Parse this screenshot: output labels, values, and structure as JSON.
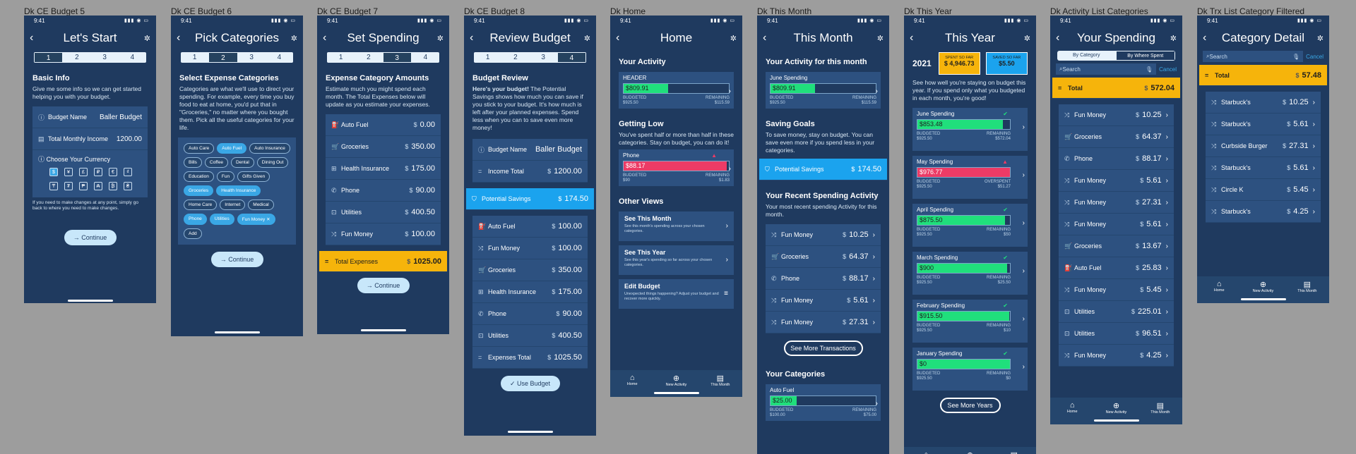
{
  "status_time": "9:41",
  "frames": {
    "f1": {
      "label": "Dk  CE Budget 5",
      "title": "Let's Start",
      "steps": [
        "1",
        "2",
        "3",
        "4"
      ],
      "heading": "Basic Info",
      "intro": "Give me some info so we can get started helping you with your budget.",
      "fields": [
        {
          "label": "Budget Name",
          "value": "Baller Budget"
        },
        {
          "label": "Total Monthly Income",
          "value": "1200.00"
        }
      ],
      "currency_label": "Choose Your Currency",
      "currencies": [
        "$",
        "¥",
        "£",
        "₽",
        "€",
        "₫",
        "₸",
        "₮",
        "₱",
        "₳",
        "₿",
        "₴"
      ],
      "note": "If you need to make changes at any point, simply go back to where you need to make changes.",
      "continue": "→ Continue"
    },
    "f2": {
      "label": "Dk  CE Budget 6",
      "title": "Pick Categories",
      "steps": [
        "1",
        "2",
        "3",
        "4"
      ],
      "heading": "Select Expense Categories",
      "intro": "Categories are what we'll use to direct your spending. For example, every time you buy food to eat at home, you'd put that in \"Groceries,\" no matter where you bought them. Pick all the useful categories for your life.",
      "chips": [
        {
          "t": "Auto Care",
          "s": false
        },
        {
          "t": "Auto Fuel",
          "s": true
        },
        {
          "t": "Auto Insurance",
          "s": false
        },
        {
          "t": "Bills",
          "s": false
        },
        {
          "t": "Coffee",
          "s": false
        },
        {
          "t": "Dental",
          "s": false
        },
        {
          "t": "Dining Out",
          "s": false
        },
        {
          "t": "Education",
          "s": false
        },
        {
          "t": "Fun",
          "s": false
        },
        {
          "t": "Gifts Given",
          "s": false
        },
        {
          "t": "Groceries",
          "s": true
        },
        {
          "t": "Health Insurance",
          "s": true
        },
        {
          "t": "Home Care",
          "s": false
        },
        {
          "t": "Internet",
          "s": false
        },
        {
          "t": "Medical",
          "s": false
        },
        {
          "t": "Phone",
          "s": true
        },
        {
          "t": "Utilities",
          "s": true
        },
        {
          "t": "Fun Money ✕",
          "s": true
        },
        {
          "t": "Add",
          "s": false
        }
      ],
      "continue": "→ Continue"
    },
    "f3": {
      "label": "Dk  CE Budget 7",
      "title": "Set Spending",
      "steps": [
        "1",
        "2",
        "3",
        "4"
      ],
      "heading": "Expense Category Amounts",
      "intro": "Estimate much you might spend each month. The Total Expenses below will update as you estimate your expenses.",
      "rows": [
        {
          "l": "Auto Fuel",
          "v": "0.00"
        },
        {
          "l": "Groceries",
          "v": "350.00"
        },
        {
          "l": "Health Insurance",
          "v": "175.00"
        },
        {
          "l": "Phone",
          "v": "90.00"
        },
        {
          "l": "Utilities",
          "v": "400.50"
        },
        {
          "l": "Fun Money",
          "v": "100.00"
        }
      ],
      "total_label": "Total Expenses",
      "total_value": "1025.00",
      "continue": "→ Continue"
    },
    "f4": {
      "label": "Dk  CE Budget 8",
      "title": "Review Budget",
      "steps": [
        "1",
        "2",
        "3",
        "4"
      ],
      "heading": "Budget Review",
      "intro_bold": "Here's your budget!",
      "intro": " The Potential Savings shows how much you can save if you stick to your budget. It's how much is left after your planned expenses. Spend less when you can to save even more money!",
      "top_rows": [
        {
          "l": "Budget Name",
          "v": "Baller Budget"
        },
        {
          "l": "Income Total",
          "v": "1200.00"
        }
      ],
      "savings_label": "Potential Savings",
      "savings_value": "174.50",
      "rows": [
        {
          "l": "Auto Fuel",
          "v": "100.00"
        },
        {
          "l": "Fun Money",
          "v": "100.00"
        },
        {
          "l": "Groceries",
          "v": "350.00"
        },
        {
          "l": "Health Insurance",
          "v": "175.00"
        },
        {
          "l": "Phone",
          "v": "90.00"
        },
        {
          "l": "Utilities",
          "v": "400.50"
        },
        {
          "l": "Expenses Total",
          "v": "1025.50"
        }
      ],
      "use_budget": "✓ Use Budget"
    },
    "f5": {
      "label": "Dk  Home",
      "title": "Home",
      "activity_heading": "Your Activity",
      "header_label": "HEADER",
      "header_amount": "$809.91",
      "header_fill": 0.42,
      "budgeted_label": "BUDGETED",
      "budgeted": "$925.50",
      "remaining_label": "REMAINING",
      "remaining": "$115.59",
      "low_heading": "Getting Low",
      "low_text": "You've spent half or more than half in these categories. Stay on budget, you can do it!",
      "phone_label": "Phone",
      "phone_amount": "$88.17",
      "phone_fill": 0.98,
      "phone_budgeted": "$90",
      "phone_remaining": "$1.83",
      "other_heading": "Other Views",
      "views": [
        {
          "t": "See This Month",
          "d": "See this month's spending across your chosen categories."
        },
        {
          "t": "See This Year",
          "d": "See this year's spending so far across your chosen categories."
        },
        {
          "t": "Edit Budget",
          "d": "Unexpected things happening? Adjust your budget and recover more quickly."
        }
      ],
      "tabs": [
        "Home",
        "New Activity",
        "This Month"
      ]
    },
    "f6": {
      "label": "Dk  This Month",
      "title": "This Month",
      "activity_heading": "Your Activity for this month",
      "june_label": "June Spending",
      "june_amount": "$809.91",
      "june_fill": 0.42,
      "budgeted_label": "BUDGETED",
      "budgeted": "$925.50",
      "remaining_label": "REMAINING",
      "remaining": "$115.59",
      "goals_heading": "Saving Goals",
      "goals_text": "To save money, stay on budget. You can save even more if you spend less in your categories.",
      "savings_label": "Potential Savings",
      "savings_value": "174.50",
      "recent_heading": "Your Recent Spending Activity",
      "recent_text": "Your most recent spending Activity for this month.",
      "rows": [
        {
          "l": "Fun Money",
          "v": "10.25"
        },
        {
          "l": "Groceries",
          "v": "64.37"
        },
        {
          "l": "Phone",
          "v": "88.17"
        },
        {
          "l": "Fun Money",
          "v": "5.61"
        },
        {
          "l": "Fun Money",
          "v": "27.31"
        }
      ],
      "see_more": "See More Transactions",
      "cat_heading": "Your Categories",
      "cat_label": "Auto Fuel",
      "cat_amount": "$25.00",
      "cat_fill": 0.25,
      "cat_budgeted": "$100.00",
      "cat_remaining": "$75.00"
    },
    "f7": {
      "label": "Dk  This Year",
      "title": "This Year",
      "year": "2021",
      "spent_label": "SPENT SO FAR",
      "spent": "$ 4,946.73",
      "saved_label": "SAVED SO FAR",
      "saved": "$5.50",
      "intro": "See how well you're staying on budget this year. If you spend only what you budgeted in each month, you're good!",
      "months": [
        {
          "t": "June Spending",
          "a": "$853.48",
          "f": 0.92,
          "over": false,
          "b": "$925.50",
          "rl": "REMAINING",
          "r": "$572.04"
        },
        {
          "t": "May Spending",
          "a": "$976.77",
          "f": 1.0,
          "over": true,
          "b": "$925.50",
          "rl": "OVERSPENT",
          "r": "$51.27"
        },
        {
          "t": "April Spending",
          "a": "$875.50",
          "f": 0.95,
          "over": false,
          "b": "$925.50",
          "rl": "REMAINING",
          "r": "$50"
        },
        {
          "t": "March Spending",
          "a": "$900",
          "f": 0.97,
          "over": false,
          "b": "$925.50",
          "rl": "REMAINING",
          "r": "$25.50"
        },
        {
          "t": "February Spending",
          "a": "$915.50",
          "f": 0.99,
          "over": false,
          "b": "$925.50",
          "rl": "REMAINING",
          "r": "$10"
        },
        {
          "t": "January Spending",
          "a": "$0",
          "f": 1.0,
          "over": false,
          "b": "$925.50",
          "rl": "REMAINING",
          "r": "$0"
        }
      ],
      "budgeted_label": "BUDGETED",
      "see_more": "See More Years"
    },
    "f8": {
      "label": "Dk  Activity List Categories",
      "title": "Your Spending",
      "seg": [
        "By Category",
        "By Where Spent"
      ],
      "search": "Search",
      "cancel": "Cancel",
      "total_label": "Total",
      "total_value": "572.04",
      "rows": [
        {
          "l": "Fun Money",
          "v": "10.25"
        },
        {
          "l": "Groceries",
          "v": "64.37"
        },
        {
          "l": "Phone",
          "v": "88.17"
        },
        {
          "l": "Fun Money",
          "v": "5.61"
        },
        {
          "l": "Fun Money",
          "v": "27.31"
        },
        {
          "l": "Fun Money",
          "v": "5.61"
        },
        {
          "l": "Groceries",
          "v": "13.67"
        },
        {
          "l": "Auto Fuel",
          "v": "25.83"
        },
        {
          "l": "Fun Money",
          "v": "5.45"
        },
        {
          "l": "Utilities",
          "v": "225.01"
        },
        {
          "l": "Utilities",
          "v": "96.51"
        },
        {
          "l": "Fun Money",
          "v": "4.25"
        }
      ],
      "tabs": [
        "Home",
        "New Activity",
        "This Month"
      ]
    },
    "f9": {
      "label": "Dk  Trx List Category Filtered",
      "title": "Category Detail",
      "search": "Search",
      "cancel": "Cancel",
      "total_label": "Total",
      "total_value": "57.48",
      "rows": [
        {
          "l": "Starbuck's",
          "v": "10.25"
        },
        {
          "l": "Starbuck's",
          "v": "5.61"
        },
        {
          "l": "Curbside Burger",
          "v": "27.31"
        },
        {
          "l": "Starbuck's",
          "v": "5.61"
        },
        {
          "l": "Circle K",
          "v": "5.45"
        },
        {
          "l": "Starbuck's",
          "v": "4.25"
        }
      ],
      "tabs": [
        "Home",
        "New Activity",
        "This Month"
      ]
    }
  }
}
